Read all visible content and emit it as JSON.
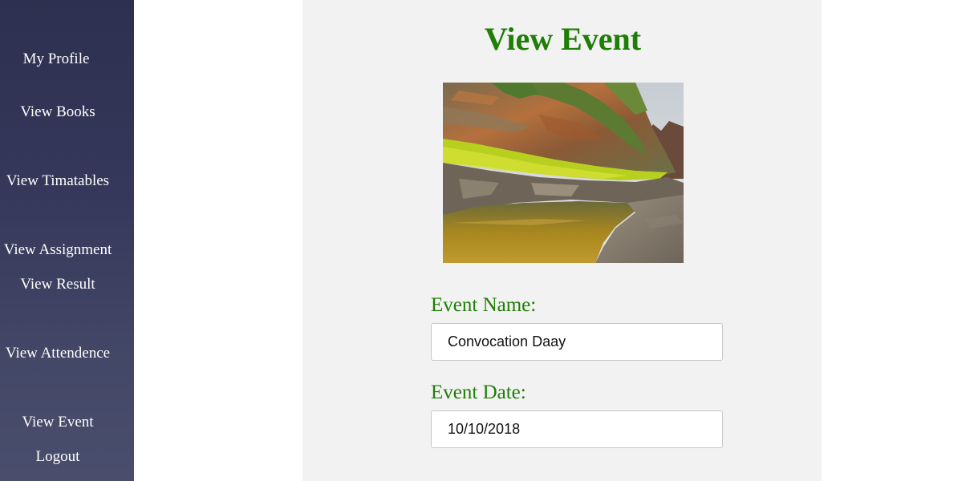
{
  "sidebar": {
    "items": [
      {
        "label": "My Profile"
      },
      {
        "label": "View Books"
      },
      {
        "label": "View Timatables"
      },
      {
        "label": "View Assignment"
      },
      {
        "label": "View Result"
      },
      {
        "label": "View Attendence"
      },
      {
        "label": "View Event"
      },
      {
        "label": "Logout"
      }
    ]
  },
  "main": {
    "title": "View Event",
    "event_name_label": "Event Name:",
    "event_name_value": "Convocation Daay",
    "event_date_label": "Event Date:",
    "event_date_value": "10/10/2018"
  },
  "colors": {
    "accent_green": "#1e7e06",
    "sidebar_bg": "#35385a",
    "panel_bg": "#f2f2f2"
  }
}
